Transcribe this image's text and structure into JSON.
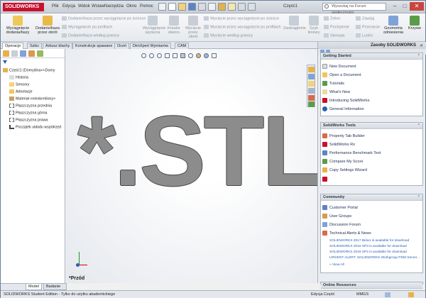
{
  "app": {
    "brand": "SOLIDWORKS",
    "document_title": "Część1",
    "search_placeholder": "Wyszukaj na Forum społeczności"
  },
  "menu": [
    "Plik",
    "Edycja",
    "Widok",
    "Wstaw",
    "Narzędzia",
    "Okno",
    "Pomoc"
  ],
  "ribbon": {
    "big": [
      {
        "label": "Wyciągnięcie dodania/bazy",
        "disabled": false
      },
      {
        "label": "Dodanie/baza przez obrót",
        "disabled": false
      }
    ],
    "col1": [
      "Dodanie/baza przez wyciągnięcie po ścieżce",
      "Wyciągnięcie po profilach",
      "Dodanie/baza według granicy"
    ],
    "mid": [
      "Wyciągnięcie wycięcia",
      "Kreator otworu",
      "Wycięcie przez obrót"
    ],
    "col2": [
      "Wycięcie przez wyciągnięcie po ścieżce",
      "Wycięcie przez wyciągnięcie po profilach",
      "Wycięcie według granicy"
    ],
    "right": [
      "Zaokrąglenie",
      "Szyk liniowy",
      "Żebro",
      "Pochylenie",
      "Skorupa",
      "Zawijaj",
      "Przecięcie",
      "Lustro"
    ],
    "geo": [
      "Geometria odniesienia",
      "Krzywe"
    ]
  },
  "tabs": [
    "Operacje",
    "Szkic",
    "Arkusz blachy",
    "Konstrukcje spawane",
    "Oceń",
    "DimXpert Wymiarów",
    "CAM"
  ],
  "tree": [
    "Część1 (Domyślna<<Domy",
    "Historia",
    "Sensory",
    "Adnotacje",
    "Materiał <nieokreślony>",
    "Płaszczyzna przednia",
    "Płaszczyzna górna",
    "Płaszczyzna prawa",
    "Początek układu współrzęd"
  ],
  "graphics": {
    "big_text": "*.STL",
    "view_label": "*Przód"
  },
  "bottom_tabs": [
    "Model",
    "Badanie ruchu 1"
  ],
  "taskpane": {
    "title": "Zasoby SOLIDWORKS",
    "sections": [
      {
        "title": "Getting Started",
        "items": [
          "New Document",
          "Open a Document",
          "Tutorials",
          "What's New",
          "Introducing SolidWorks",
          "General Information"
        ]
      },
      {
        "title": "SolidWorks Tools",
        "items": [
          "Property Tab Builder",
          "SolidWorks Rx",
          "Performance Benchmark Test",
          "Compare My Score",
          "Copy Settings Wizard"
        ]
      },
      {
        "title": "Community",
        "items": [
          "Customer Portal",
          "User Groups",
          "Discussion Forum",
          "Technical Alerts & News"
        ]
      }
    ],
    "news": [
      "SOLIDWORKS 2017 Beta1 is available for download",
      "SOLIDWORKS 2016 SP3 is available for download",
      "SOLIDWORKS 2016 SP2 is available for download",
      "URGENT ALERT: SOLIDWORKS Workgroup PDM Server...",
      "» View All"
    ],
    "online_resources": "Online Resources"
  },
  "status": {
    "left": "SOLIDWORKS Student Edition - Tylko do użytku akademickiego",
    "mode": "Edycja Część",
    "units": "MMGS"
  }
}
